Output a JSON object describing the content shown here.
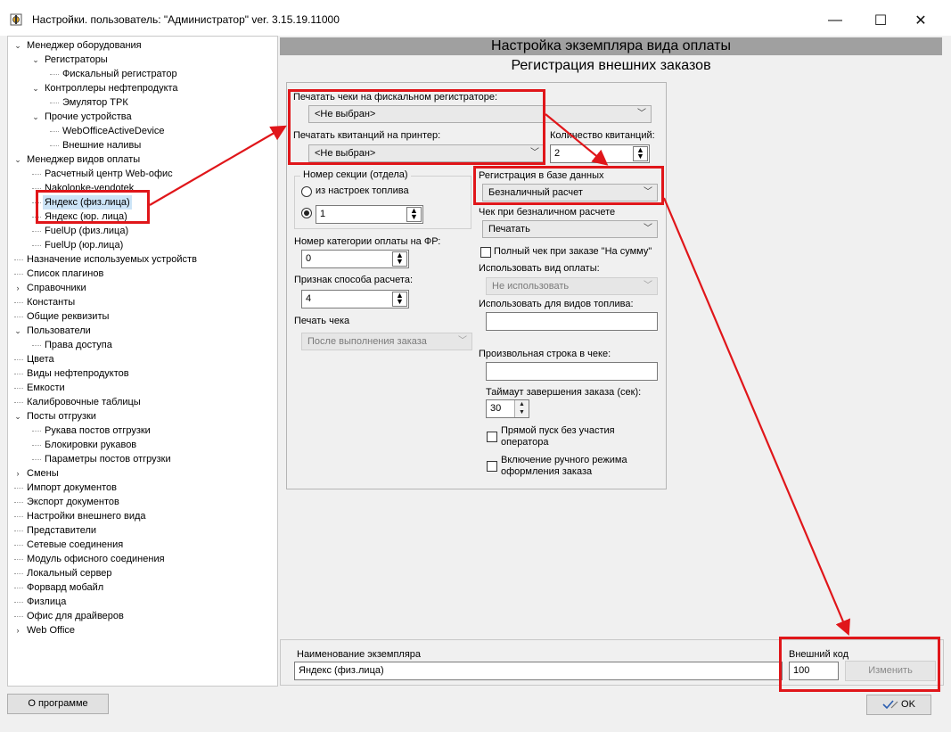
{
  "window": {
    "title": "Настройки. пользователь: \"Администратор\" ver. 3.15.19.11000",
    "minimize_glyph": "—",
    "maximize_glyph": "☐",
    "close_glyph": "✕"
  },
  "tree": {
    "items": [
      {
        "label": "Менеджер оборудования",
        "expanded": true
      },
      {
        "label": "Регистраторы",
        "expanded": true
      },
      {
        "label": "Фискальный регистратор"
      },
      {
        "label": "Контроллеры нефтепродукта",
        "expanded": true
      },
      {
        "label": "Эмулятор ТРК"
      },
      {
        "label": "Прочие устройства",
        "expanded": true
      },
      {
        "label": "WebOfficeActiveDevice"
      },
      {
        "label": "Внешние наливы"
      },
      {
        "label": "Менеджер видов оплаты",
        "expanded": true
      },
      {
        "label": "Расчетный центр Web-офис"
      },
      {
        "label": "Nakolonke-vendotek"
      },
      {
        "label": "Яндекс (физ.лица)",
        "selected": true
      },
      {
        "label": "Яндекс (юр. лица)"
      },
      {
        "label": "FuelUp (физ.лица)"
      },
      {
        "label": "FuelUp (юр.лица)"
      },
      {
        "label": "Назначение используемых устройств"
      },
      {
        "label": "Список плагинов"
      },
      {
        "label": "Справочники",
        "expanded": false
      },
      {
        "label": "Константы"
      },
      {
        "label": "Общие реквизиты"
      },
      {
        "label": "Пользователи",
        "expanded": true
      },
      {
        "label": "Права доступа"
      },
      {
        "label": "Цвета"
      },
      {
        "label": "Виды нефтепродуктов"
      },
      {
        "label": "Емкости"
      },
      {
        "label": "Калибровочные таблицы"
      },
      {
        "label": "Посты отгрузки",
        "expanded": true
      },
      {
        "label": "Рукава постов отгрузки"
      },
      {
        "label": "Блокировки рукавов"
      },
      {
        "label": "Параметры постов отгрузки"
      },
      {
        "label": "Смены",
        "expanded": false
      },
      {
        "label": "Импорт документов"
      },
      {
        "label": "Экспорт документов"
      },
      {
        "label": "Настройки внешнего вида"
      },
      {
        "label": "Представители"
      },
      {
        "label": "Сетевые соединения"
      },
      {
        "label": "Модуль офисного соединения"
      },
      {
        "label": "Локальный сервер"
      },
      {
        "label": "Форвард мобайл"
      },
      {
        "label": "Физлица"
      },
      {
        "label": "Офис для драйверов"
      },
      {
        "label": "Web Office",
        "expanded": false
      }
    ]
  },
  "header": {
    "title": "Настройка экземпляра вида оплаты",
    "subtitle": "Регистрация внешних заказов"
  },
  "form": {
    "fiscal_print_label": "Печатать чеки на фискальном регистраторе:",
    "fiscal_print_value": "<Не выбран>",
    "receipt_printer_label": "Печатать квитанций на принтер:",
    "receipt_printer_value": "<Не выбран>",
    "receipt_count_label": "Количество квитанций:",
    "receipt_count_value": "2",
    "section_group_title": "Номер секции (отдела)",
    "section_radio_settings_label": "из настроек топлива",
    "section_radio_value": "1",
    "payment_category_label": "Номер категории оплаты на ФР:",
    "payment_category_value": "0",
    "payment_method_label": "Признак способа расчета:",
    "payment_method_value": "4",
    "print_receipt_label": "Печать чека",
    "print_receipt_value": "После выполнения заказа",
    "db_registration_label": "Регистрация в базе данных",
    "db_registration_value": "Безналичный расчет",
    "cashless_receipt_label": "Чек при безналичном расчете",
    "cashless_receipt_value": "Печатать",
    "full_receipt_label": "Полный чек при заказе \"На сумму\"",
    "use_payment_type_label": "Использовать вид оплаты:",
    "use_payment_type_value": "Не использовать",
    "use_for_fuel_label": "Использовать для видов топлива:",
    "use_for_fuel_value": "",
    "custom_line_label": "Произвольная строка в чеке:",
    "custom_line_value": "",
    "timeout_label": "Таймаут завершения заказа (сек):",
    "timeout_value": "30",
    "direct_start_label_1": "Прямой пуск без участия",
    "direct_start_label_2": "оператора",
    "manual_mode_label_1": "Включение ручного режима",
    "manual_mode_label_2": "оформления заказа"
  },
  "bottom": {
    "instance_name_label": "Наименование экземпляра",
    "instance_name_value": "Яндекс (физ.лица)",
    "external_code_label": "Внешний код",
    "external_code_value": "100",
    "change_button": "Изменить"
  },
  "footer": {
    "about_button": "О программе",
    "ok_button": "OK"
  },
  "colors": {
    "annotation_red": "#e0161a",
    "header_band": "#a0a0a0",
    "selection": "#cce4f7"
  }
}
